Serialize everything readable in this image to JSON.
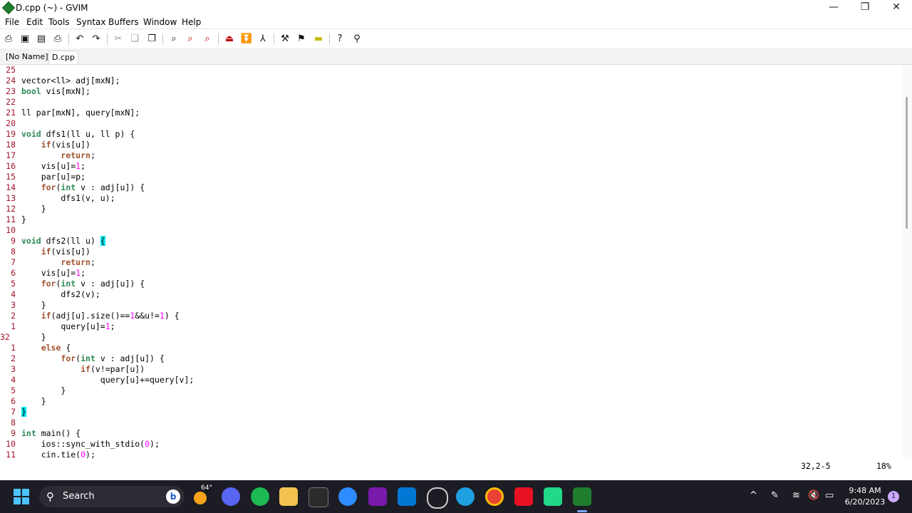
{
  "window": {
    "title": "D.cpp (~) - GVIM"
  },
  "menu": [
    "File",
    "Edit",
    "Tools",
    "Syntax",
    "Buffers",
    "Window",
    "Help"
  ],
  "tabs": [
    "[No Name]",
    "D.cpp"
  ],
  "editor": {
    "status_position": "32,2-5",
    "status_percent": "18%",
    "lines": [
      {
        "n": "25",
        "segs": []
      },
      {
        "n": "24",
        "segs": [
          [
            "vector<ll> adj[mxN];",
            ""
          ]
        ]
      },
      {
        "n": "23",
        "segs": [
          [
            "bool",
            "ty"
          ],
          [
            " vis[mxN];",
            ""
          ]
        ]
      },
      {
        "n": "22",
        "segs": []
      },
      {
        "n": "21",
        "segs": [
          [
            "ll par[mxN], query[mxN];",
            ""
          ]
        ]
      },
      {
        "n": "20",
        "segs": []
      },
      {
        "n": "19",
        "segs": [
          [
            "void",
            "ty"
          ],
          [
            " dfs1(ll u, ll p) {",
            ""
          ]
        ]
      },
      {
        "n": "18",
        "segs": [
          [
            "    ",
            ""
          ],
          [
            "if",
            "kw"
          ],
          [
            "(vis[u])",
            ""
          ]
        ]
      },
      {
        "n": "17",
        "segs": [
          [
            "        ",
            ""
          ],
          [
            "return",
            "kw"
          ],
          [
            ";",
            ""
          ]
        ]
      },
      {
        "n": "16",
        "segs": [
          [
            "    vis[u]=",
            ""
          ],
          [
            "1",
            "num"
          ],
          [
            ";",
            ""
          ]
        ]
      },
      {
        "n": "15",
        "segs": [
          [
            "    par[u]=p;",
            ""
          ]
        ]
      },
      {
        "n": "14",
        "segs": [
          [
            "    ",
            ""
          ],
          [
            "for",
            "kw"
          ],
          [
            "(",
            ""
          ],
          [
            "int",
            "ty"
          ],
          [
            " v : adj[u]) {",
            ""
          ]
        ]
      },
      {
        "n": "13",
        "segs": [
          [
            "        dfs1(v, u);",
            ""
          ]
        ]
      },
      {
        "n": "12",
        "segs": [
          [
            "    }",
            ""
          ]
        ]
      },
      {
        "n": "11",
        "segs": [
          [
            "}",
            ""
          ]
        ]
      },
      {
        "n": "10",
        "segs": []
      },
      {
        "n": "9",
        "segs": [
          [
            "void",
            "ty"
          ],
          [
            " dfs2(ll u) ",
            ""
          ],
          [
            "{",
            "hl"
          ]
        ]
      },
      {
        "n": "8",
        "segs": [
          [
            "    ",
            ""
          ],
          [
            "if",
            "kw"
          ],
          [
            "(vis[u])",
            ""
          ]
        ]
      },
      {
        "n": "7",
        "segs": [
          [
            "        ",
            ""
          ],
          [
            "return",
            "kw"
          ],
          [
            ";",
            ""
          ]
        ]
      },
      {
        "n": "6",
        "segs": [
          [
            "    vis[u]=",
            ""
          ],
          [
            "1",
            "num"
          ],
          [
            ";",
            ""
          ]
        ]
      },
      {
        "n": "5",
        "segs": [
          [
            "    ",
            ""
          ],
          [
            "for",
            "kw"
          ],
          [
            "(",
            ""
          ],
          [
            "int",
            "ty"
          ],
          [
            " v : adj[u]) {",
            ""
          ]
        ]
      },
      {
        "n": "4",
        "segs": [
          [
            "        dfs2(v);",
            ""
          ]
        ]
      },
      {
        "n": "3",
        "segs": [
          [
            "    }",
            ""
          ]
        ]
      },
      {
        "n": "2",
        "segs": [
          [
            "    ",
            ""
          ],
          [
            "if",
            "kw"
          ],
          [
            "(adj[u].size()==",
            ""
          ],
          [
            "1",
            "num"
          ],
          [
            "&&u!=",
            ""
          ],
          [
            "1",
            "num"
          ],
          [
            ") {",
            ""
          ]
        ]
      },
      {
        "n": "1",
        "segs": [
          [
            "        query[u]=",
            ""
          ],
          [
            "1",
            "num"
          ],
          [
            ";",
            ""
          ]
        ]
      },
      {
        "n": "32",
        "cur": true,
        "segs": [
          [
            "    }",
            ""
          ]
        ]
      },
      {
        "n": "1",
        "segs": [
          [
            "    ",
            ""
          ],
          [
            "else",
            "kw"
          ],
          [
            " {",
            ""
          ]
        ]
      },
      {
        "n": "2",
        "segs": [
          [
            "        ",
            ""
          ],
          [
            "for",
            "kw"
          ],
          [
            "(",
            ""
          ],
          [
            "int",
            "ty"
          ],
          [
            " v : adj[u]) {",
            ""
          ]
        ]
      },
      {
        "n": "3",
        "segs": [
          [
            "            ",
            ""
          ],
          [
            "if",
            "kw"
          ],
          [
            "(v!=par[u])",
            ""
          ]
        ]
      },
      {
        "n": "4",
        "segs": [
          [
            "                query[u]+=query[v];",
            ""
          ]
        ]
      },
      {
        "n": "5",
        "segs": [
          [
            "        }",
            ""
          ]
        ]
      },
      {
        "n": "6",
        "segs": [
          [
            "    }",
            ""
          ]
        ]
      },
      {
        "n": "7",
        "segs": [
          [
            "}",
            "hl"
          ]
        ]
      },
      {
        "n": "8",
        "segs": []
      },
      {
        "n": "9",
        "segs": [
          [
            "int",
            "ty"
          ],
          [
            " main() {",
            ""
          ]
        ]
      },
      {
        "n": "10",
        "segs": [
          [
            "    ios::sync_with_stdio(",
            ""
          ],
          [
            "0",
            "num"
          ],
          [
            ");",
            ""
          ]
        ]
      },
      {
        "n": "11",
        "segs": [
          [
            "    cin.tie(",
            ""
          ],
          [
            "0",
            "num"
          ],
          [
            ");",
            ""
          ]
        ]
      }
    ]
  },
  "taskbar": {
    "search_label": "Search",
    "weather": "64°",
    "time": "9:48 AM",
    "date": "6/20/2023",
    "notification_count": "1"
  }
}
